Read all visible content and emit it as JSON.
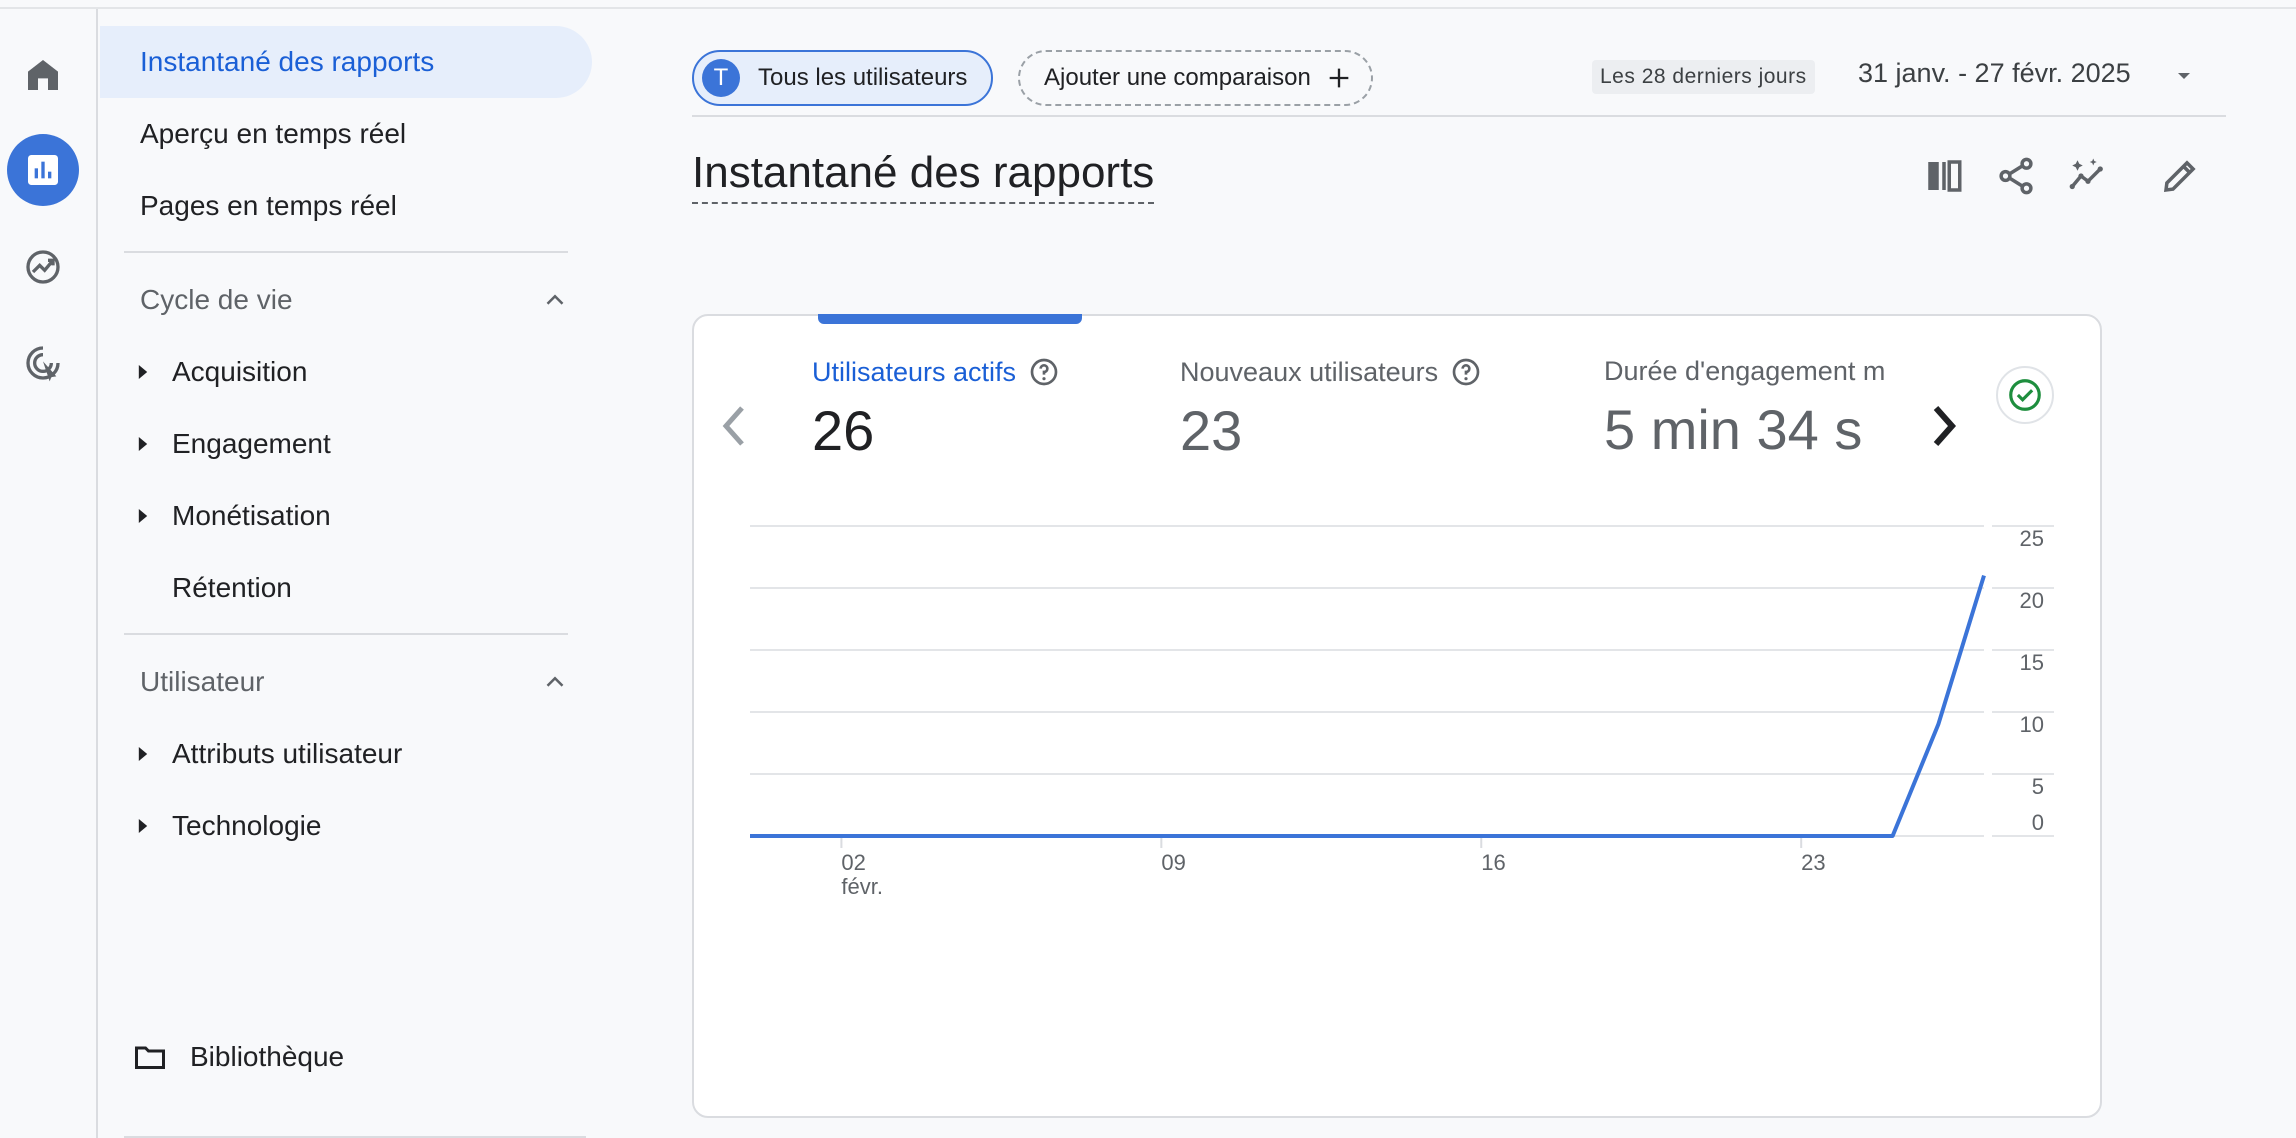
{
  "rail": {
    "items": [
      {
        "name": "home-icon",
        "active": false
      },
      {
        "name": "reports-icon",
        "active": true
      },
      {
        "name": "explore-icon",
        "active": false
      },
      {
        "name": "advertising-icon",
        "active": false
      }
    ]
  },
  "nav": {
    "top_items": [
      {
        "label": "Instantané des rapports",
        "active": true
      },
      {
        "label": "Aperçu en temps réel",
        "active": false
      },
      {
        "label": "Pages en temps réel",
        "active": false
      }
    ],
    "lifecycle": {
      "title": "Cycle de vie",
      "items": [
        {
          "label": "Acquisition",
          "expandable": true
        },
        {
          "label": "Engagement",
          "expandable": true
        },
        {
          "label": "Monétisation",
          "expandable": true
        },
        {
          "label": "Rétention",
          "expandable": false
        }
      ]
    },
    "user": {
      "title": "Utilisateur",
      "items": [
        {
          "label": "Attributs utilisateur",
          "expandable": true
        },
        {
          "label": "Technologie",
          "expandable": true
        }
      ]
    },
    "library_label": "Bibliothèque"
  },
  "filters": {
    "users_chip_avatar": "T",
    "users_chip_label": "Tous les utilisateurs",
    "compare_label": "Ajouter une comparaison",
    "date_tag": "Les 28 derniers jours",
    "date_range": "31 janv. - 27 févr. 2025"
  },
  "page_title": "Instantané des rapports",
  "toolbar_icons": [
    "compare-columns-icon",
    "share-icon",
    "insights-icon",
    "edit-icon"
  ],
  "metrics": [
    {
      "label": "Utilisateurs actifs",
      "value": "26",
      "active": true,
      "help": true
    },
    {
      "label": "Nouveaux utilisateurs",
      "value": "23",
      "active": false,
      "help": true
    },
    {
      "label": "Durée d'engagement m",
      "value": "5 min 34 s",
      "active": false,
      "help": false
    }
  ],
  "colors": {
    "accent": "#3b74d8",
    "active_text": "#1a5fd6",
    "check_green": "#1e8e3e"
  },
  "chart_data": {
    "type": "line",
    "x_tick_labels": [
      {
        "label": "02",
        "sub": "févr."
      },
      {
        "label": "09",
        "sub": ""
      },
      {
        "label": "16",
        "sub": ""
      },
      {
        "label": "23",
        "sub": ""
      }
    ],
    "x_tick_days": [
      2,
      9,
      16,
      23
    ],
    "y_ticks": [
      0,
      5,
      10,
      15,
      20,
      25
    ],
    "ylim": [
      0,
      25
    ],
    "grid": true,
    "series": [
      {
        "name": "Utilisateurs actifs",
        "points": [
          {
            "day": 0,
            "value": 0
          },
          {
            "day": 1,
            "value": 0
          },
          {
            "day": 2,
            "value": 0
          },
          {
            "day": 3,
            "value": 0
          },
          {
            "day": 4,
            "value": 0
          },
          {
            "day": 5,
            "value": 0
          },
          {
            "day": 6,
            "value": 0
          },
          {
            "day": 7,
            "value": 0
          },
          {
            "day": 8,
            "value": 0
          },
          {
            "day": 9,
            "value": 0
          },
          {
            "day": 10,
            "value": 0
          },
          {
            "day": 11,
            "value": 0
          },
          {
            "day": 12,
            "value": 0
          },
          {
            "day": 13,
            "value": 0
          },
          {
            "day": 14,
            "value": 0
          },
          {
            "day": 15,
            "value": 0
          },
          {
            "day": 16,
            "value": 0
          },
          {
            "day": 17,
            "value": 0
          },
          {
            "day": 18,
            "value": 0
          },
          {
            "day": 19,
            "value": 0
          },
          {
            "day": 20,
            "value": 0
          },
          {
            "day": 21,
            "value": 0
          },
          {
            "day": 22,
            "value": 0
          },
          {
            "day": 23,
            "value": 0
          },
          {
            "day": 24,
            "value": 0
          },
          {
            "day": 25,
            "value": 0
          },
          {
            "day": 26,
            "value": 9
          },
          {
            "day": 27,
            "value": 21
          }
        ]
      }
    ]
  }
}
